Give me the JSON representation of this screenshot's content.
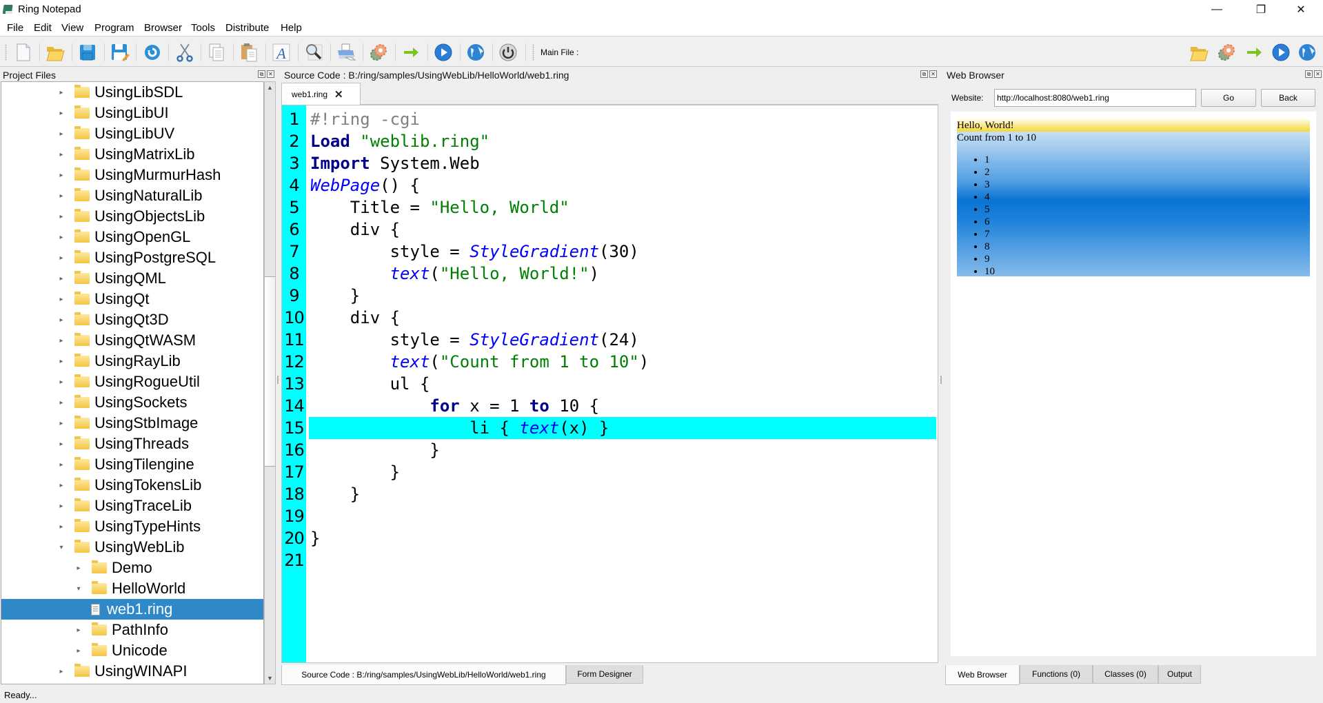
{
  "window": {
    "title": "Ring Notepad",
    "controls": [
      "minimize-icon",
      "restore-icon",
      "close-icon"
    ]
  },
  "menubar": [
    "File",
    "Edit",
    "View",
    "Program",
    "Browser",
    "Tools",
    "Distribute",
    "Help"
  ],
  "toolbar": {
    "left_icons": [
      "new-file-icon",
      "open-folder-icon",
      "save-icon",
      "save-as-icon",
      "undo-icon",
      "cut-icon",
      "copy-icon",
      "paste-icon",
      "font-icon",
      "find-icon",
      "print-icon",
      "debug-gear-icon",
      "run-arrow-icon",
      "run-play-icon",
      "web-globe-icon",
      "quit-power-icon"
    ],
    "main_file_label": "Main File :",
    "right_icons": [
      "open-folder-icon",
      "debug-gear-icon",
      "run-arrow-icon",
      "run-play-icon",
      "web-globe-icon"
    ]
  },
  "project_files": {
    "title": "Project Files",
    "items": [
      {
        "label": "UsingLibSDL",
        "level": 1,
        "type": "folder",
        "expanded": false
      },
      {
        "label": "UsingLibUI",
        "level": 1,
        "type": "folder",
        "expanded": false
      },
      {
        "label": "UsingLibUV",
        "level": 1,
        "type": "folder",
        "expanded": false
      },
      {
        "label": "UsingMatrixLib",
        "level": 1,
        "type": "folder",
        "expanded": false
      },
      {
        "label": "UsingMurmurHash",
        "level": 1,
        "type": "folder",
        "expanded": false
      },
      {
        "label": "UsingNaturalLib",
        "level": 1,
        "type": "folder",
        "expanded": false
      },
      {
        "label": "UsingObjectsLib",
        "level": 1,
        "type": "folder",
        "expanded": false
      },
      {
        "label": "UsingOpenGL",
        "level": 1,
        "type": "folder",
        "expanded": false
      },
      {
        "label": "UsingPostgreSQL",
        "level": 1,
        "type": "folder",
        "expanded": false
      },
      {
        "label": "UsingQML",
        "level": 1,
        "type": "folder",
        "expanded": false
      },
      {
        "label": "UsingQt",
        "level": 1,
        "type": "folder",
        "expanded": false
      },
      {
        "label": "UsingQt3D",
        "level": 1,
        "type": "folder",
        "expanded": false
      },
      {
        "label": "UsingQtWASM",
        "level": 1,
        "type": "folder",
        "expanded": false
      },
      {
        "label": "UsingRayLib",
        "level": 1,
        "type": "folder",
        "expanded": false
      },
      {
        "label": "UsingRogueUtil",
        "level": 1,
        "type": "folder",
        "expanded": false
      },
      {
        "label": "UsingSockets",
        "level": 1,
        "type": "folder",
        "expanded": false
      },
      {
        "label": "UsingStbImage",
        "level": 1,
        "type": "folder",
        "expanded": false
      },
      {
        "label": "UsingThreads",
        "level": 1,
        "type": "folder",
        "expanded": false
      },
      {
        "label": "UsingTilengine",
        "level": 1,
        "type": "folder",
        "expanded": false
      },
      {
        "label": "UsingTokensLib",
        "level": 1,
        "type": "folder",
        "expanded": false
      },
      {
        "label": "UsingTraceLib",
        "level": 1,
        "type": "folder",
        "expanded": false
      },
      {
        "label": "UsingTypeHints",
        "level": 1,
        "type": "folder",
        "expanded": false
      },
      {
        "label": "UsingWebLib",
        "level": 1,
        "type": "folder",
        "expanded": true
      },
      {
        "label": "Demo",
        "level": 2,
        "type": "folder",
        "expanded": false
      },
      {
        "label": "HelloWorld",
        "level": 2,
        "type": "folder",
        "expanded": true
      },
      {
        "label": "web1.ring",
        "level": 3,
        "type": "file",
        "selected": true
      },
      {
        "label": "PathInfo",
        "level": 2,
        "type": "folder",
        "expanded": false
      },
      {
        "label": "Unicode",
        "level": 2,
        "type": "folder",
        "expanded": false
      },
      {
        "label": "UsingWINAPI",
        "level": 1,
        "type": "folder",
        "expanded": false
      }
    ]
  },
  "source_code": {
    "title": "Source Code : B:/ring/samples/UsingWebLib/HelloWorld/web1.ring",
    "tab_label": "web1.ring",
    "highlighted_line": 15,
    "lines": [
      [
        {
          "t": "#!ring -cgi",
          "c": "cm"
        }
      ],
      [
        {
          "t": "Load",
          "c": "kw"
        },
        {
          "t": " "
        },
        {
          "t": "\"weblib.ring\"",
          "c": "str"
        }
      ],
      [
        {
          "t": "Import",
          "c": "kw"
        },
        {
          "t": " System.Web"
        }
      ],
      [
        {
          "t": "WebPage",
          "c": "fn"
        },
        {
          "t": "() {"
        }
      ],
      [
        {
          "t": "    Title = "
        },
        {
          "t": "\"Hello, World\"",
          "c": "str"
        }
      ],
      [
        {
          "t": "    div {"
        }
      ],
      [
        {
          "t": "        style = "
        },
        {
          "t": "StyleGradient",
          "c": "fn"
        },
        {
          "t": "(30)"
        }
      ],
      [
        {
          "t": "        "
        },
        {
          "t": "text",
          "c": "fn"
        },
        {
          "t": "("
        },
        {
          "t": "\"Hello, World!\"",
          "c": "str"
        },
        {
          "t": ")"
        }
      ],
      [
        {
          "t": "    }"
        }
      ],
      [
        {
          "t": "    div {"
        }
      ],
      [
        {
          "t": "        style = "
        },
        {
          "t": "StyleGradient",
          "c": "fn"
        },
        {
          "t": "(24)"
        }
      ],
      [
        {
          "t": "        "
        },
        {
          "t": "text",
          "c": "fn"
        },
        {
          "t": "("
        },
        {
          "t": "\"Count from 1 to 10\"",
          "c": "str"
        },
        {
          "t": ")"
        }
      ],
      [
        {
          "t": "        ul {"
        }
      ],
      [
        {
          "t": "            "
        },
        {
          "t": "for",
          "c": "kw"
        },
        {
          "t": " x = 1 "
        },
        {
          "t": "to",
          "c": "kw"
        },
        {
          "t": " 10 {"
        }
      ],
      [
        {
          "t": "                li { "
        },
        {
          "t": "text",
          "c": "fn"
        },
        {
          "t": "(x) }"
        }
      ],
      [
        {
          "t": "            }"
        }
      ],
      [
        {
          "t": "        }"
        }
      ],
      [
        {
          "t": "    }"
        }
      ],
      [],
      [
        {
          "t": "}"
        }
      ],
      []
    ],
    "bottom_tabs": [
      {
        "label": "Source Code : B:/ring/samples/UsingWebLib/HelloWorld/web1.ring",
        "active": true
      },
      {
        "label": "Form Designer",
        "active": false
      }
    ]
  },
  "web_browser": {
    "title": "Web Browser",
    "website_label": "Website:",
    "url": "http://localhost:8080/web1.ring",
    "go_label": "Go",
    "back_label": "Back",
    "page": {
      "hello": "Hello, World!",
      "count_title": "Count from 1 to 10",
      "list": [
        "1",
        "2",
        "3",
        "4",
        "5",
        "6",
        "7",
        "8",
        "9",
        "10"
      ]
    },
    "bottom_tabs": [
      {
        "label": "Web Browser",
        "active": true
      },
      {
        "label": "Functions (0)",
        "active": false
      },
      {
        "label": "Classes (0)",
        "active": false
      },
      {
        "label": "Output",
        "active": false
      }
    ]
  },
  "status": "Ready..."
}
